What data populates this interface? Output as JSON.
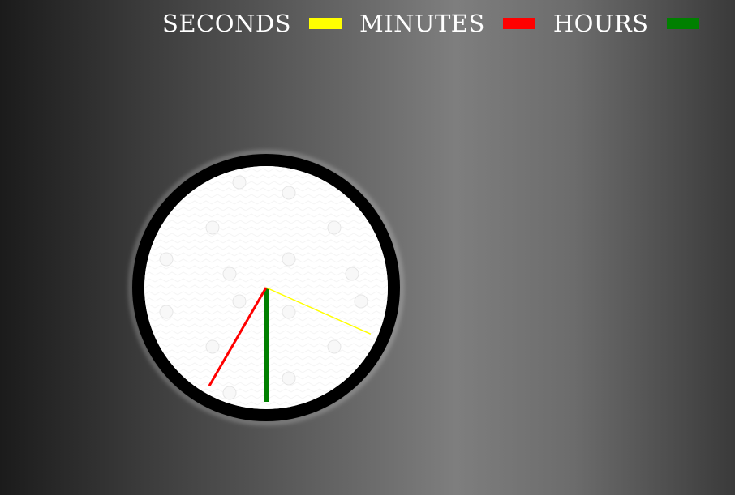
{
  "legend": {
    "seconds": {
      "label": "SECONDS",
      "color": "#ffff00"
    },
    "minutes": {
      "label": "MINUTES",
      "color": "#ff0000"
    },
    "hours": {
      "label": "HOURS",
      "color": "#008000"
    }
  },
  "clock": {
    "face_color": "#ffffff",
    "rim_color": "#000000",
    "dot_color": "#f8f8f8",
    "hands": {
      "seconds": {
        "angle_deg": 114,
        "color": "#ffff00"
      },
      "minutes": {
        "angle_deg": 210,
        "color": "#ff0000"
      },
      "hours": {
        "angle_deg": 180,
        "color": "#008000"
      }
    }
  }
}
